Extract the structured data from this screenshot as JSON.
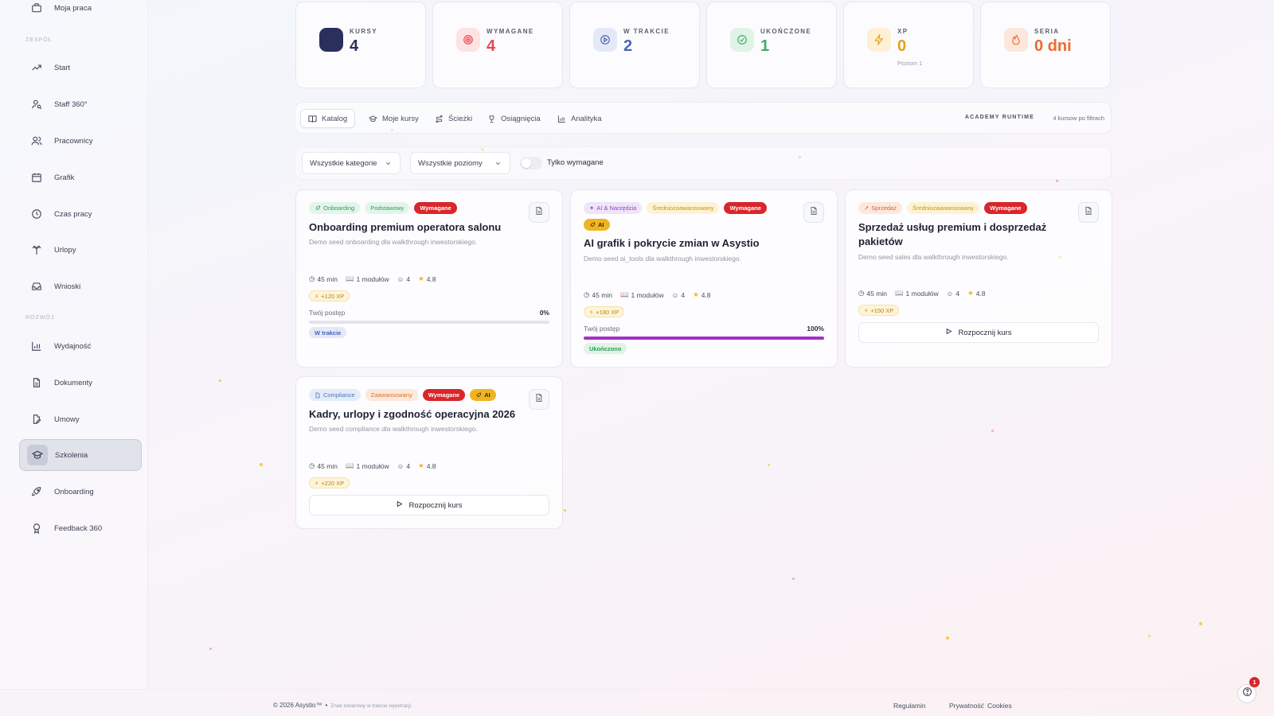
{
  "sidebar": {
    "top_item": "Moja praca",
    "section_team": "ZESPÓŁ",
    "section_dev": "ROZWÓJ",
    "items": [
      {
        "label": "Start",
        "icon": "trend-up-icon"
      },
      {
        "label": "Staff 360°",
        "icon": "user-search-icon"
      },
      {
        "label": "Pracownicy",
        "icon": "users-icon"
      },
      {
        "label": "Grafik",
        "icon": "calendar-icon"
      },
      {
        "label": "Czas pracy",
        "icon": "clock-icon"
      },
      {
        "label": "Urlopy",
        "icon": "palm-tree-icon"
      },
      {
        "label": "Wnioski",
        "icon": "inbox-icon"
      },
      {
        "label": "Wydajność",
        "icon": "bar-chart-icon"
      },
      {
        "label": "Dokumenty",
        "icon": "document-icon"
      },
      {
        "label": "Umowy",
        "icon": "file-edit-icon"
      },
      {
        "label": "Szkolenia",
        "icon": "graduation-cap-icon",
        "active": true
      },
      {
        "label": "Onboarding",
        "icon": "rocket-icon"
      },
      {
        "label": "Feedback 360",
        "icon": "award-icon"
      }
    ]
  },
  "stats": [
    {
      "label": "KURSY",
      "value": "4",
      "color": "#2b2f5c",
      "icon": "square-icon"
    },
    {
      "label": "WYMAGANE",
      "value": "4",
      "color": "#e14b52",
      "icon": "target-icon"
    },
    {
      "label": "W TRAKCIE",
      "value": "2",
      "color": "#4a63b8",
      "icon": "play-circle-icon"
    },
    {
      "label": "UKOŃCZONE",
      "value": "1",
      "color": "#3fae6a",
      "icon": "check-circle-icon"
    },
    {
      "label": "XP",
      "value": "0",
      "sub": "Poziom 1",
      "color": "#e3a21a",
      "icon": "zap-icon"
    },
    {
      "label": "SERIA",
      "value": "0 dni",
      "color": "#ef6a2e",
      "icon": "flame-icon"
    }
  ],
  "tabs": [
    {
      "label": "Katalog",
      "icon": "book-open-icon",
      "active": true
    },
    {
      "label": "Moje kursy",
      "icon": "graduation-cap-icon"
    },
    {
      "label": "Ścieżki",
      "icon": "route-icon"
    },
    {
      "label": "Osiągnięcia",
      "icon": "trophy-icon"
    },
    {
      "label": "Analityka",
      "icon": "bar-chart-icon"
    }
  ],
  "runtime_label": "ACADEMY RUNTIME",
  "course_count": "4 kursow po filtrach",
  "filters": {
    "category": "Wszystkie kategorie",
    "level": "Wszystkie poziomy",
    "required_only": "Tylko wymagane"
  },
  "courses": [
    {
      "tags": [
        {
          "text": "Onboarding",
          "kind": "category-green",
          "icon": "rocket-icon"
        },
        {
          "text": "Podstawowy",
          "kind": "level-green"
        },
        {
          "text": "Wymagane",
          "kind": "required"
        }
      ],
      "title": "Onboarding premium operatora salonu",
      "desc": "Demo seed onboarding dla walkthrough inwestorskiego.",
      "duration": "45 min",
      "modules": "1 modułów",
      "learners": "4",
      "rating": "4.8",
      "xp": "+120 XP",
      "progress_label": "Twój postęp",
      "progress_pct": "0%",
      "progress": 0,
      "status": "W trakcie"
    },
    {
      "tags": [
        {
          "text": "AI & Narzędzia",
          "kind": "category-purple",
          "icon": "sparkles-icon"
        },
        {
          "text": "Średniozaawansowany",
          "kind": "level-yellow"
        },
        {
          "text": "Wymagane",
          "kind": "required"
        },
        {
          "text": "AI",
          "kind": "ai",
          "icon": "rocket-icon"
        }
      ],
      "title": "AI grafik i pokrycie zmian w Asystio",
      "desc": "Demo seed ai_tools dla walkthrough inwestorskiego.",
      "duration": "45 min",
      "modules": "1 modułów",
      "learners": "4",
      "rating": "4.8",
      "xp": "+180 XP",
      "progress_label": "Twój postęp",
      "progress_pct": "100%",
      "progress": 1,
      "status": "Ukończono"
    },
    {
      "tags": [
        {
          "text": "Sprzedaż",
          "kind": "category-orange",
          "icon": "trend-up-icon"
        },
        {
          "text": "Średniozaawansowany",
          "kind": "level-yellow"
        },
        {
          "text": "Wymagane",
          "kind": "required"
        }
      ],
      "title": "Sprzedaż usług premium i dosprzedaż pakietów",
      "desc": "Demo seed sales dla walkthrough inwestorskiego.",
      "duration": "45 min",
      "modules": "1 modułów",
      "learners": "4",
      "rating": "4.8",
      "xp": "+150 XP",
      "button": "Rozpocznij kurs"
    },
    {
      "tags": [
        {
          "text": "Compliance",
          "kind": "category-blue",
          "icon": "document-icon"
        },
        {
          "text": "Zaawansowany",
          "kind": "level-orange"
        },
        {
          "text": "Wymagane",
          "kind": "required"
        },
        {
          "text": "AI",
          "kind": "ai",
          "icon": "rocket-icon"
        }
      ],
      "title": "Kadry, urlopy i zgodność operacyjna 2026",
      "desc": "Demo seed compliance dla walkthrough inwestorskiego.",
      "duration": "45 min",
      "modules": "1 modułów",
      "learners": "4",
      "rating": "4.8",
      "xp": "+220 XP",
      "button": "Rozpocznij kurs"
    }
  ],
  "footer": {
    "copyright": "© 2026 Asystio™",
    "separator": "•",
    "trademark": "Znak towarowy w trakcie rejestracji",
    "links": [
      "Regulamin",
      "Prywatność",
      "Cookies"
    ]
  },
  "help_badge": "1"
}
